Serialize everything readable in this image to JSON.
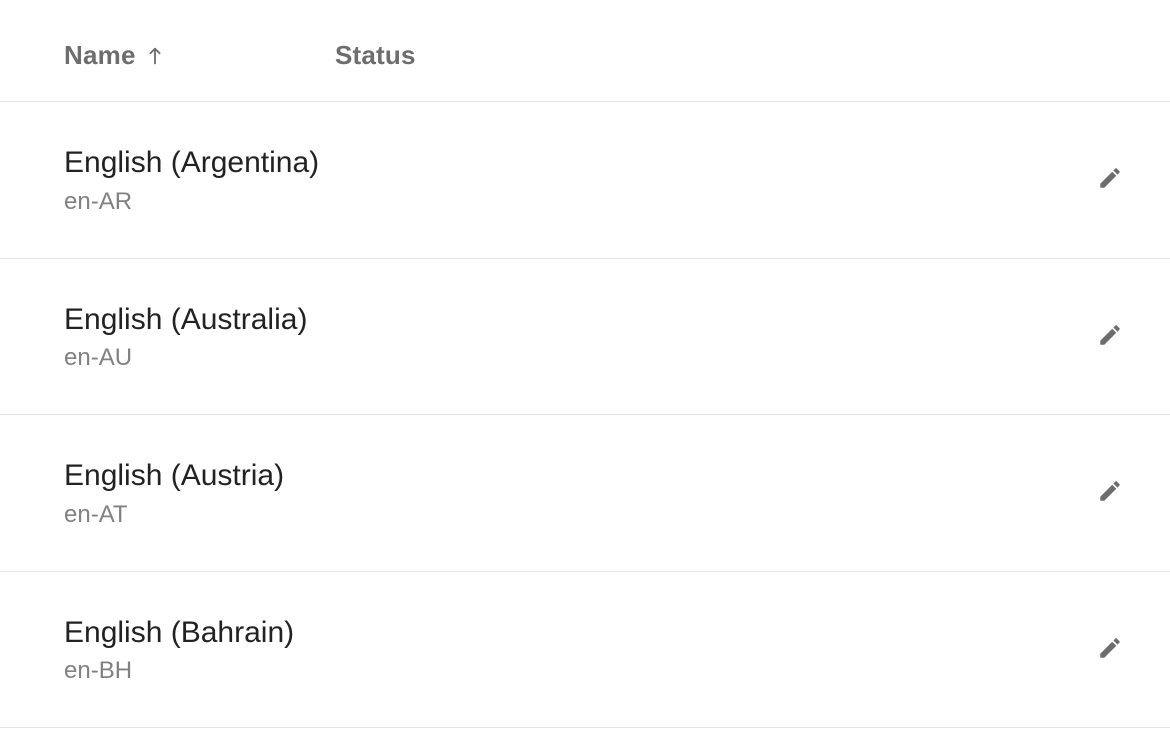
{
  "columns": {
    "name": "Name",
    "status": "Status",
    "sort_direction": "asc"
  },
  "rows": [
    {
      "name": "English (Argentina)",
      "code": "en-AR",
      "status": ""
    },
    {
      "name": "English (Australia)",
      "code": "en-AU",
      "status": ""
    },
    {
      "name": "English (Austria)",
      "code": "en-AT",
      "status": ""
    },
    {
      "name": "English (Bahrain)",
      "code": "en-BH",
      "status": ""
    }
  ],
  "icons": {
    "edit": "edit-icon",
    "sort_asc": "sort-asc-icon"
  }
}
